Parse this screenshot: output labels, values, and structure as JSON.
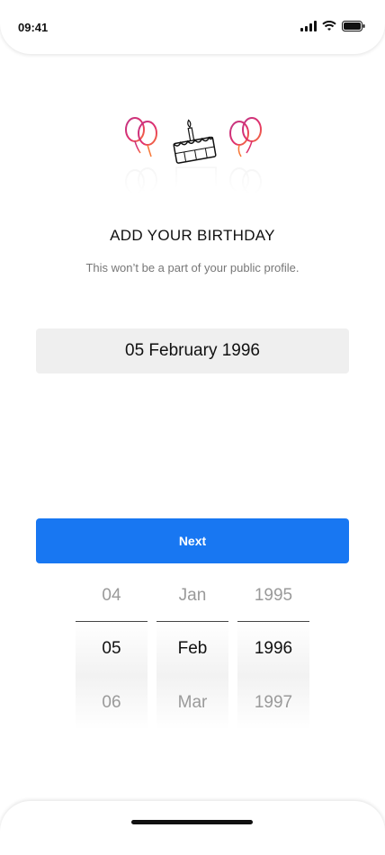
{
  "status_bar": {
    "time": "09:41",
    "icons": [
      "cellular-icon",
      "wifi-icon",
      "battery-icon"
    ]
  },
  "illustration": {
    "name": "birthday-balloons-cake-icon"
  },
  "title": "ADD YOUR BIRTHDAY",
  "subtitle": "This won’t be a part of your public profile.",
  "date_field": {
    "value": "05 February 1996"
  },
  "next_button": {
    "label": "Next",
    "color": "#1877f2"
  },
  "picker": {
    "day": {
      "prev": "04",
      "selected": "05",
      "next": "06"
    },
    "month": {
      "prev": "Jan",
      "selected": "Feb",
      "next": "Mar"
    },
    "year": {
      "prev": "1995",
      "selected": "1996",
      "next": "1997"
    }
  }
}
